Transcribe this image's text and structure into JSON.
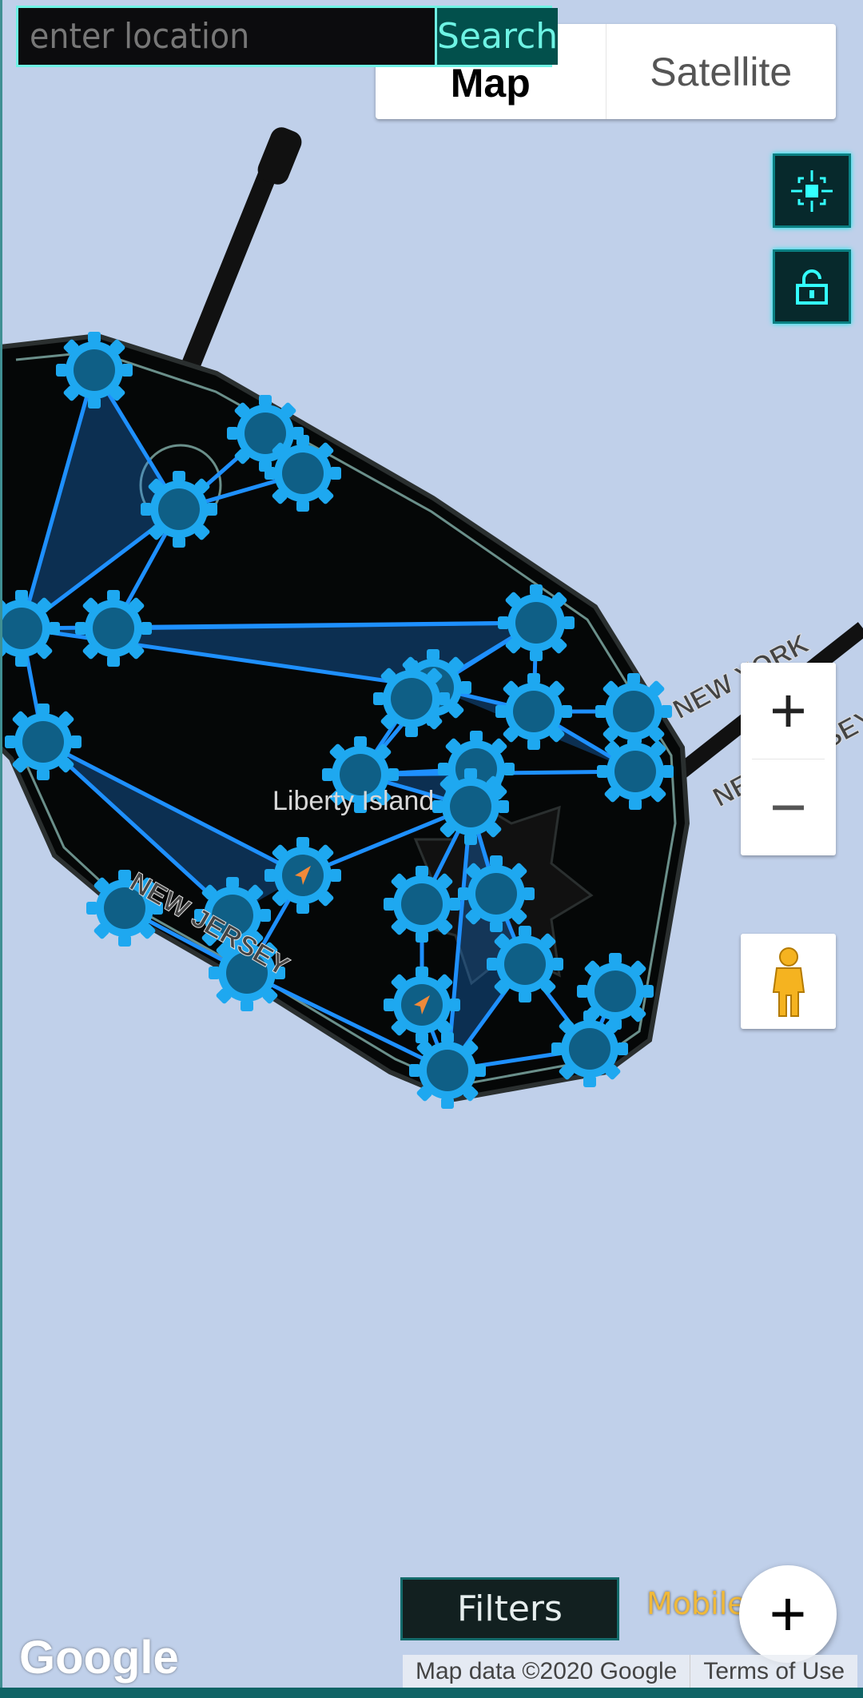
{
  "search": {
    "placeholder": "enter location",
    "button_label": "Search"
  },
  "map_type": {
    "map_label": "Map",
    "satellite_label": "Satellite",
    "selected": "Map"
  },
  "controls": {
    "locate_icon": "crosshair-icon",
    "lock_icon": "unlock-icon",
    "zoom_in_label": "+",
    "zoom_out_label": "−",
    "pegman_icon": "pegman-icon"
  },
  "map_labels": {
    "island": "Liberty Island",
    "state_ny": "NEW YORK",
    "state_nj": "NEW JERSEY",
    "state_nj_right": "NEW JERSEY"
  },
  "bottom": {
    "filters_label": "Filters",
    "mobile_label": "Mobile",
    "fab_label": "+",
    "attribution": "Map data ©2020 Google",
    "terms": "Terms of Use",
    "logo": "Google"
  },
  "colors": {
    "water": "#c0d0ea",
    "land": "#050707",
    "portal": "#1ea8f0",
    "link": "#1e90ff",
    "accent": "#6ef3e4",
    "mobile": "#f0b93a"
  }
}
